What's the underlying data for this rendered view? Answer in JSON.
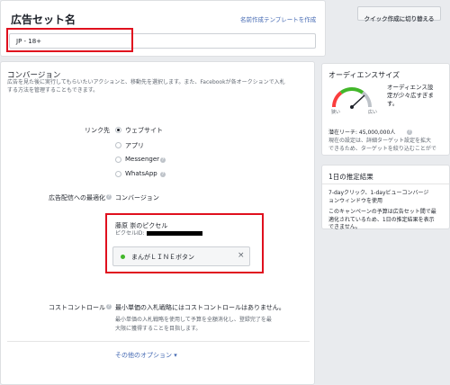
{
  "adset": {
    "title": "広告セット名",
    "template_link": "名前作成テンプレートを作成",
    "quick_button": "クイック作成に切り替える",
    "name_value": "JP - 18+"
  },
  "conversion": {
    "heading": "コンバージョン",
    "desc_line1": "広告を見た後に実行してもらいたいアクションと、移動先を選択します。また、Facebookが各オークションで入札",
    "desc_line2": "する方法を管理することもできます。",
    "link_label": "リンク先",
    "options": [
      {
        "label": "ウェブサイト",
        "selected": true
      },
      {
        "label": "アプリ",
        "selected": false
      },
      {
        "label": "Messenger",
        "selected": false
      },
      {
        "label": "WhatsApp",
        "selected": false
      }
    ],
    "optimization_label": "広告配信への最適化",
    "optimization_value": "コンバージョン",
    "pixel_name": "藤原 崇のピクセル",
    "pixel_id_label": "ピクセルID:",
    "event_name": "まんがＬＩＮＥボタン",
    "event_status_color": "#42b72a",
    "cost_label": "コストコントロール",
    "cost_text": "最小単価の入札戦略にはコストコントロールはありません。",
    "cost_note_line1": "最小単価の入札戦略を使用して予算を全額消化し、登録完了を最",
    "cost_note_line2": "大限に獲得することを目指します。",
    "more_options": "その他のオプション ▾"
  },
  "audience": {
    "heading": "オーディエンスサイズ",
    "gauge_note_line1": "オーディエンス設",
    "gauge_note_line2": "定が少々広すぎま",
    "gauge_note_line3": "す。",
    "gauge_low": "狭い",
    "gauge_high": "広い",
    "reach": "潜在リーチ: 45,000,000人",
    "reach_note_line1": "現在の設定は、詳細ターゲット設定を拡大",
    "reach_note_line2": "できるため、ターゲットを絞り込むことがで"
  },
  "estimate": {
    "heading": "1日の推定結果",
    "line1": "7-dayクリック、1-dayビューコンバージ",
    "line2": "ョンウィンドウを使用",
    "note_line1": "このキャンペーンの予算は広告セット間で最",
    "note_line2": "適化されているため、1日の推定結果を表示",
    "note_line3": "できません。"
  }
}
